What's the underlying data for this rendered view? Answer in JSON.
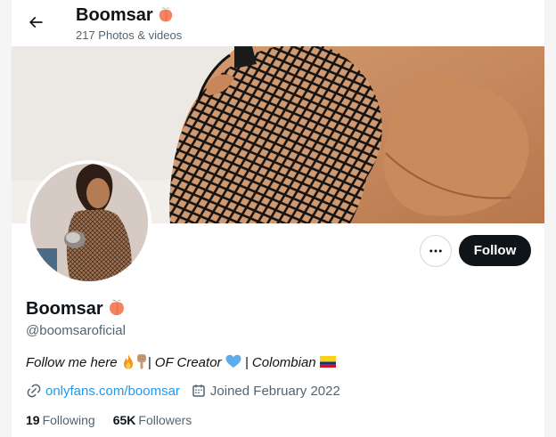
{
  "header": {
    "title": "Boomsar",
    "subtitle": "217 Photos & videos",
    "back_icon": "arrow-left-icon"
  },
  "profile": {
    "display_name": "Boomsar",
    "name_emoji": "peach-emoji",
    "handle": "@boomsaroficial",
    "bio": {
      "part1": "Follow me here ",
      "part2": "| OF Creator ",
      "part3": " | Colombian "
    },
    "website": "onlyfans.com/boomsar",
    "joined": "Joined February 2022"
  },
  "actions": {
    "follow_label": "Follow",
    "more_icon": "ellipsis-icon"
  },
  "stats": {
    "following_count": "19",
    "following_label": "Following",
    "followers_count": "65K",
    "followers_label": "Followers"
  },
  "colors": {
    "accent": "#1d9bf0",
    "text": "#0f1419",
    "secondary": "#536471",
    "follow_bg": "#0f1419"
  }
}
